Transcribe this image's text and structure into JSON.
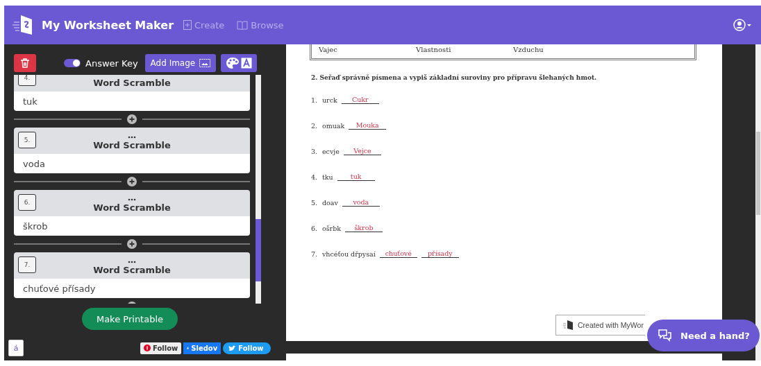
{
  "header": {
    "title": "My Worksheet Maker",
    "nav": [
      {
        "kind": "create",
        "label": "Create"
      },
      {
        "kind": "browse",
        "label": "Browse"
      }
    ]
  },
  "toolbar": {
    "answer_key": {
      "label": "Answer Key",
      "on": true
    },
    "add_image": "Add Image"
  },
  "questions": [
    {
      "number": "4.",
      "title": "Word Scramble",
      "answer": "tuk"
    },
    {
      "number": "5.",
      "title": "Word Scramble",
      "answer": "voda"
    },
    {
      "number": "6.",
      "title": "Word Scramble",
      "answer": "škrob"
    },
    {
      "number": "7.",
      "title": "Word Scramble",
      "answer": "chuťové přísady"
    }
  ],
  "make_printable": "Make Printable",
  "char_button": "á",
  "social": [
    {
      "kind": "pinterest",
      "label": "Follow"
    },
    {
      "kind": "facebook",
      "label": "Sledov"
    },
    {
      "kind": "twitter",
      "label": "Follow"
    }
  ],
  "worksheet": {
    "table_row": [
      "Vajec",
      "Vlastnosti",
      "Vzduchu"
    ],
    "instruction": "2. Seřaď správně písmena a vypiš základní suroviny pro přípravu šlehaných hmot.",
    "items": [
      {
        "number": "1.",
        "scrambled": "urck",
        "answers": [
          "Cukr"
        ]
      },
      {
        "number": "2.",
        "scrambled": "omuak",
        "answers": [
          "Mouka"
        ]
      },
      {
        "number": "3.",
        "scrambled": "ecvje",
        "answers": [
          "Vejce"
        ]
      },
      {
        "number": "4.",
        "scrambled": "tku",
        "answers": [
          "tuk"
        ]
      },
      {
        "number": "5.",
        "scrambled": "doav",
        "answers": [
          "voda"
        ]
      },
      {
        "number": "6.",
        "scrambled": "ošrbk",
        "answers": [
          "škrob"
        ]
      },
      {
        "number": "7.",
        "scrambled": "vhcéťou dřpysaí",
        "answers": [
          "chuťové",
          "přísady"
        ]
      }
    ]
  },
  "credit": "Created with MyWor",
  "help_button": "Need a hand?"
}
